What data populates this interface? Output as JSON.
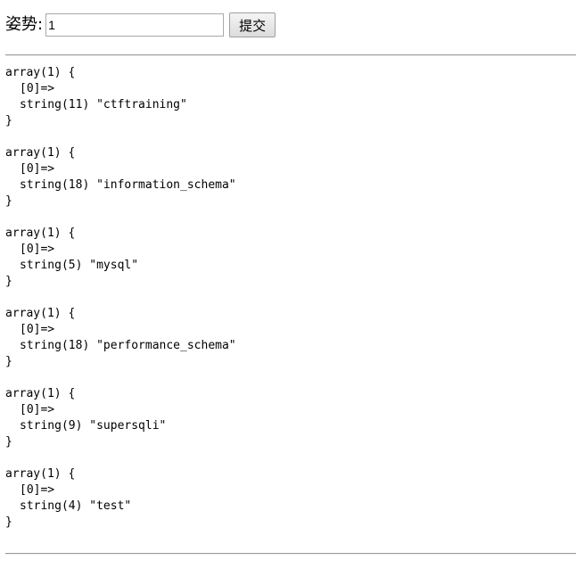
{
  "form": {
    "label": "姿势:",
    "input_value": "1",
    "submit_label": "提交"
  },
  "results": [
    {
      "header": "array(1) {",
      "key": "[0]=>",
      "value": "string(11) \"ctftraining\"",
      "close": "}"
    },
    {
      "header": "array(1) {",
      "key": "[0]=>",
      "value": "string(18) \"information_schema\"",
      "close": "}"
    },
    {
      "header": "array(1) {",
      "key": "[0]=>",
      "value": "string(5) \"mysql\"",
      "close": "}"
    },
    {
      "header": "array(1) {",
      "key": "[0]=>",
      "value": "string(18) \"performance_schema\"",
      "close": "}"
    },
    {
      "header": "array(1) {",
      "key": "[0]=>",
      "value": "string(9) \"supersqli\"",
      "close": "}"
    },
    {
      "header": "array(1) {",
      "key": "[0]=>",
      "value": "string(4) \"test\"",
      "close": "}"
    }
  ]
}
